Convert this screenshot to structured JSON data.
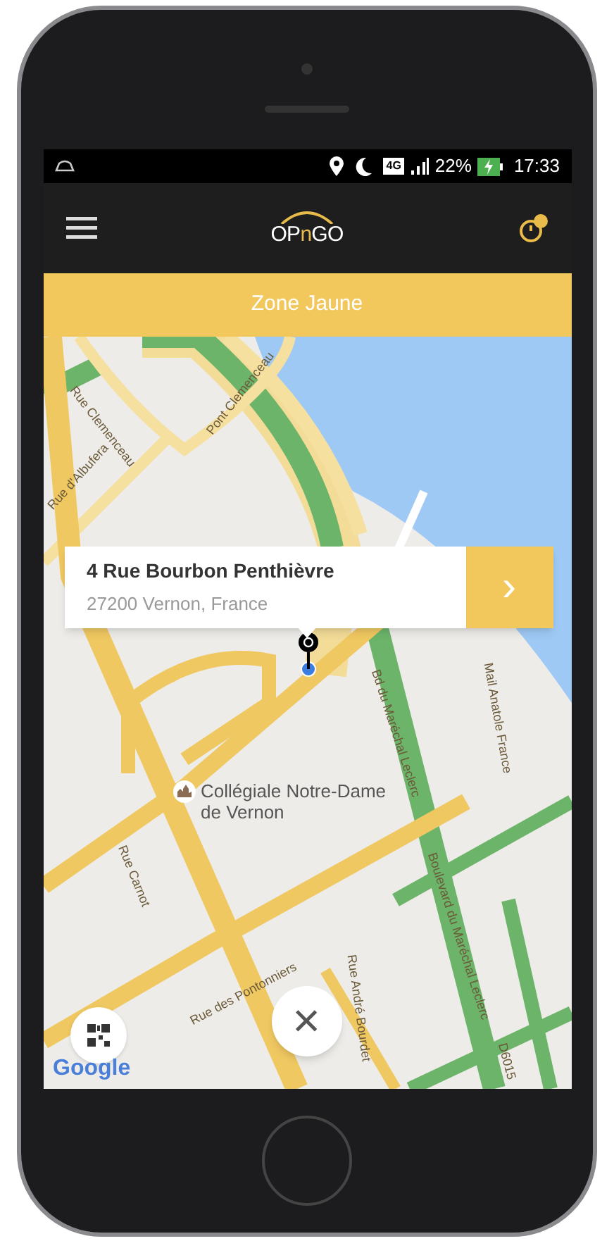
{
  "status_bar": {
    "network": "4G",
    "battery": "22%",
    "time": "17:33"
  },
  "app_bar": {
    "logo": [
      {
        "text": "OP",
        "accent": false
      },
      {
        "text": "n",
        "accent": true
      },
      {
        "text": "GO",
        "accent": false
      }
    ]
  },
  "zone_banner": {
    "label": "Zone Jaune"
  },
  "map": {
    "labels": [
      {
        "text": "Rue Clemenceau"
      },
      {
        "text": "Pont Clemenceau"
      },
      {
        "text": "Rue d'Albufera"
      },
      {
        "text": "Rue Carnot"
      },
      {
        "text": "Bd du Maréchal Leclerc"
      },
      {
        "text": "Mail Anatole France"
      },
      {
        "text": "Boulevard du Maréchal Leclerc"
      },
      {
        "text": "Rue des Pontonniers"
      },
      {
        "text": "Rue André Bourdet"
      },
      {
        "text": "D6015"
      }
    ],
    "poi": {
      "name": "Collégiale Notre-Dame de Vernon"
    },
    "attribution": "Google"
  },
  "address_card": {
    "title": "4 Rue Bourbon Penthièvre",
    "subtitle": "27200 Vernon, France",
    "action": "›"
  },
  "close_button": {
    "label": "×"
  }
}
